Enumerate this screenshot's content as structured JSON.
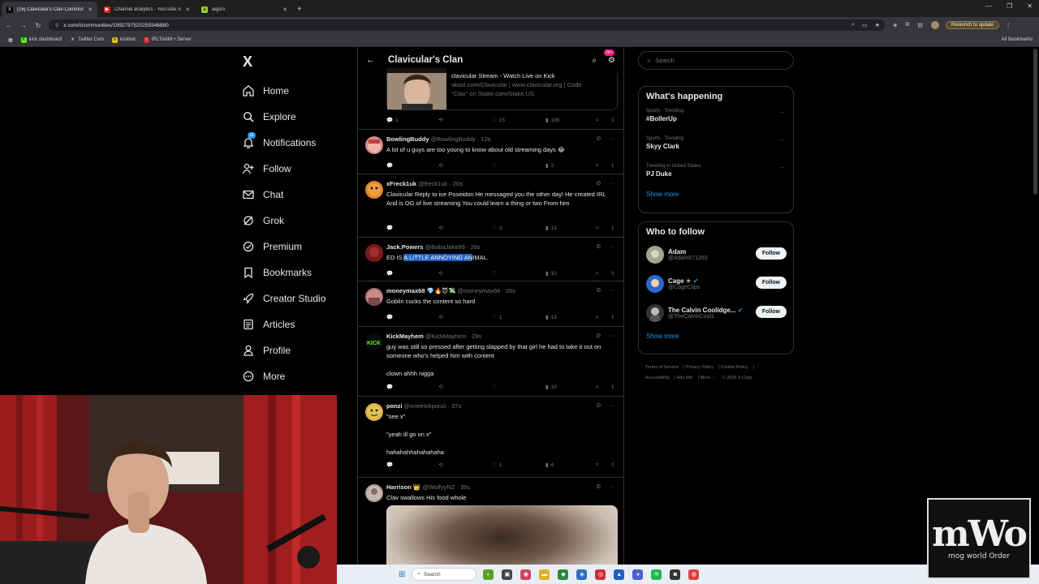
{
  "browser": {
    "tabs": [
      {
        "title": "(16) Clavicular's Clan Communi",
        "active": true,
        "fav": "X"
      },
      {
        "title": "Channel analytics - YouTube St",
        "active": false,
        "fav": "▶"
      },
      {
        "title": "algorx",
        "active": false,
        "fav": "a"
      }
    ],
    "url": "x.com/i/communities/1992797520259346880",
    "relaunch": "Relaunch to update",
    "bookmarks": [
      "kick dashboard",
      "Twitter Com",
      "kickbot",
      "IRLToolkit • Server"
    ],
    "all_bookmarks": "All Bookmarks"
  },
  "nav": {
    "logo": "X",
    "items": [
      "Home",
      "Explore",
      "Notifications",
      "Follow",
      "Chat",
      "Grok",
      "Premium",
      "Bookmarks",
      "Creator Studio",
      "Articles",
      "Profile",
      "More"
    ],
    "notif_badge": "16"
  },
  "feed": {
    "title": "Clavicular's Clan",
    "header_badge": "20+",
    "preview": {
      "line1": "clavicular Stream - Watch Live on Kick",
      "line2": "skool.com/Clavicular | www.clavicular.org | Code",
      "line3": "\"Clav\" on Stake.com/Stake.US",
      "stats": {
        "reply": "1",
        "like": "15",
        "views": "18K"
      }
    },
    "tweets": [
      {
        "name": "BowlingBuddy",
        "handle": "@BowlingBuddy · 12s",
        "text": "A lot of u guys are too young to know about old streaming days 😂",
        "reply": "",
        "like": "",
        "views": "2"
      },
      {
        "name": "xFreck1uk",
        "handle": "@freck1uk · 20s",
        "text": "Clavicular Reply to ice Poseidon He messaged you the other day! He created IRL And is OG of live streaming You could learn a thing or two From him",
        "reply": "",
        "like": "3",
        "views": "13"
      },
      {
        "name": "Jack.Powers",
        "handle": "@BabaJake99 · 26s",
        "text_pre": "ED IS ",
        "text_hl": "A LITTLE ANNOYING AN",
        "text_post": "IMAL.",
        "like": "",
        "views": "10"
      },
      {
        "name": "moneymax68 💎🔥😈💸",
        "handle": "@moneymax68 · 26s",
        "text": "Goblin cucks the content so hard",
        "like": "1",
        "views": "18"
      },
      {
        "name": "KickMayhem",
        "handle": "@KickMayhem · 29s",
        "text": "guy was still so pressed after getting slapped by that girl he had to take it out on someone who's helped him with content",
        "text2": "clown ahhh nigga",
        "like": "",
        "views": "10"
      },
      {
        "name": "ponzi",
        "handle": "@onetrickponzi · 37s",
        "text": "\"see x\"",
        "text2": "\"yeah ill go on x\"",
        "text3": "hahahahhahahahaha",
        "like": "1",
        "views": "4"
      },
      {
        "name": "Harrison 👑",
        "handle": "@WolfyyNZ · 39s",
        "text": "Clav swallows His food whole"
      }
    ]
  },
  "sidebar": {
    "search_placeholder": "Search",
    "happening_title": "What's happening",
    "trends": [
      {
        "cat": "Sports · Trending",
        "name": "#BollerUp"
      },
      {
        "cat": "Sports · Trending",
        "name": "Skyy Clark"
      },
      {
        "cat": "Trending in United States",
        "name": "PJ Duke"
      }
    ],
    "show_more": "Show more",
    "who_title": "Who to follow",
    "who": [
      {
        "name": "Adam",
        "handle": "@Adam671263",
        "btn": "Follow"
      },
      {
        "name": "Cage ✭",
        "handle": "@CageClips",
        "btn": "Follow"
      },
      {
        "name": "The Calvin Coolidge...",
        "handle": "@TheCalvinCool1",
        "btn": "Follow"
      }
    ],
    "footer": [
      "Terms of Service",
      "Privacy Policy",
      "Cookie Policy",
      "Accessibility",
      "Ads info",
      "More ···",
      "© 2026 X Corp."
    ]
  },
  "taskbar": {
    "search": "Search"
  },
  "watermark": {
    "big": "mWo",
    "small": "mog world Order"
  }
}
